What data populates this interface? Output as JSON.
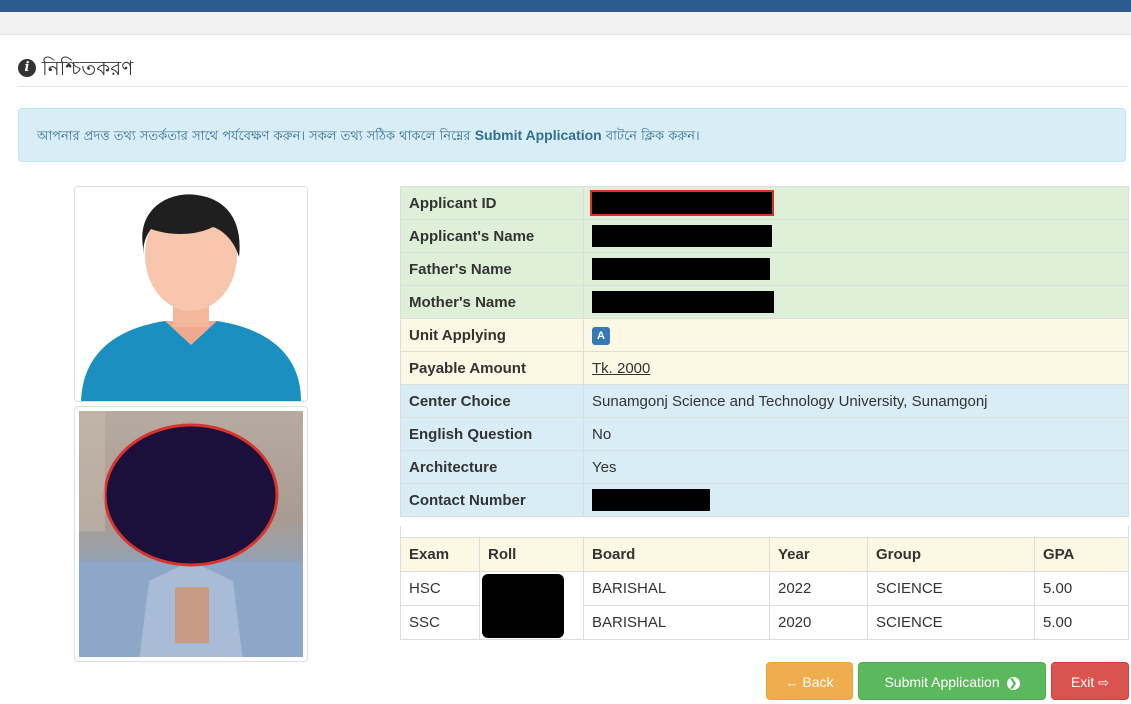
{
  "heading": {
    "title": "নিশ্চিতকরণ",
    "icon": "info-circle-icon"
  },
  "alert": {
    "text_before": "আপনার প্রদত্ত তথ্য সতর্কতার সাথে পর্যবেক্ষণ করুন। সকল তথ্য সঠিক থাকলে নিম্নের ",
    "bold": "Submit Application",
    "text_after": " বাটনে ক্লিক করুন।"
  },
  "info": {
    "applicant_id_label": "Applicant ID",
    "applicant_name_label": "Applicant's Name",
    "father_name_label": "Father's Name",
    "mother_name_label": "Mother's Name",
    "unit_label": "Unit Applying",
    "unit_value": "A",
    "payable_label": "Payable Amount",
    "payable_value": "Tk. 2000",
    "center_label": "Center Choice",
    "center_value": "Sunamgonj Science and Technology University, Sunamgonj",
    "english_label": "English Question",
    "english_value": "No",
    "architecture_label": "Architecture",
    "architecture_value": "Yes",
    "contact_label": "Contact Number"
  },
  "exam_table": {
    "headers": [
      "Exam",
      "Roll",
      "Board",
      "Year",
      "Group",
      "GPA"
    ],
    "rows": [
      {
        "exam": "HSC",
        "board": "BARISHAL",
        "year": "2022",
        "group": "SCIENCE",
        "gpa": "5.00"
      },
      {
        "exam": "SSC",
        "board": "BARISHAL",
        "year": "2020",
        "group": "SCIENCE",
        "gpa": "5.00"
      }
    ]
  },
  "buttons": {
    "back": "Back",
    "submit": "Submit Application",
    "exit": "Exit"
  },
  "colors": {
    "topbar": "#2e5b8f",
    "success": "#5cb85c",
    "warning": "#f0ad4e",
    "danger": "#d9534f",
    "info_bg": "#d9edf7"
  }
}
